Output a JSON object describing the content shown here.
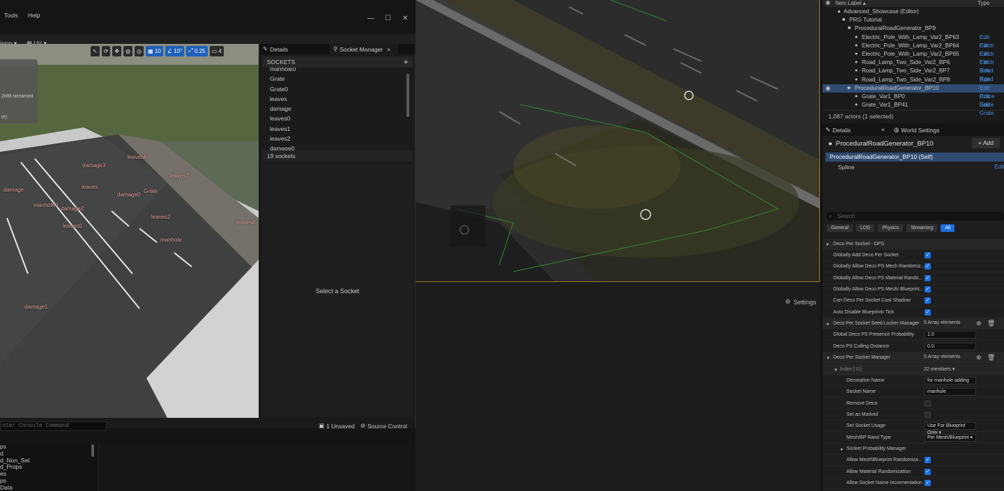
{
  "menubar": {
    "tools": "Tools",
    "help": "Help"
  },
  "window_controls": {
    "minimize": "—",
    "maximize": "☐",
    "close": "✕"
  },
  "toolbar": {
    "left_label": "ision",
    "uv_label": "UV"
  },
  "viewport_tools": {
    "grid": "10",
    "angle": "10°",
    "scale": "0.25",
    "camera": "4"
  },
  "stats_box": {
    "line1": "2MB streamed",
    "line2": "te)"
  },
  "viewport_tags": [
    "damage3",
    "leaves6",
    "leaves7",
    "leaves",
    "Grate",
    "damage",
    "damage0",
    "manhole0",
    "damage2",
    "leaves2",
    "leaves8",
    "leaves0",
    "manhole",
    "damage1"
  ],
  "panel_tabs": {
    "details": "Details",
    "socket_manager": "Socket Manager",
    "close": "×"
  },
  "sockets": {
    "header": "SOCKETS",
    "items": [
      "manhole0",
      "Grate",
      "Grate0",
      "leaves",
      "damage",
      "leaves0",
      "leaves1",
      "leaves2",
      "damage0"
    ],
    "count": "19 sockets",
    "empty_message": "Select a Socket"
  },
  "console": {
    "placeholder": "nter Console Command"
  },
  "status": {
    "unsaved": "1 Unsaved",
    "source_control": "Source Control"
  },
  "bottom_list": [
    "ps",
    "d",
    "d_Non_Set",
    "d_Props",
    "es",
    "ps",
    "Data"
  ],
  "settings": {
    "label": "Settings"
  },
  "outliner": {
    "col_label": "Item Label ▴",
    "col_type": "Type",
    "rows": [
      {
        "label": "Advanced_Showcase (Editor)",
        "edit": ""
      },
      {
        "label": "PRG Tutorial",
        "edit": ""
      },
      {
        "label": "ProceduralRoadGenerator_BP9",
        "edit": ""
      },
      {
        "label": "Electric_Pole_With_Lamp_Var2_BP63",
        "edit": "Edit Electr"
      },
      {
        "label": "Electric_Pole_With_Lamp_Var2_BP64",
        "edit": "Edit Electr"
      },
      {
        "label": "Electric_Pole_With_Lamp_Var2_BP65",
        "edit": "Edit Electr"
      },
      {
        "label": "Road_Lamp_Two_Side_Var2_BP6",
        "edit": "Edit Road"
      },
      {
        "label": "Road_Lamp_Two_Side_Var2_BP7",
        "edit": "Edit Road"
      },
      {
        "label": "Road_Lamp_Two_Side_Var2_BP8",
        "edit": "Edit Road"
      },
      {
        "label": "ProceduralRoadGenerator_BP10",
        "edit": "Edit Proce"
      },
      {
        "label": "Grate_Var1_BP0",
        "edit": "Edit Grate"
      },
      {
        "label": "Grate_Var1_BP41",
        "edit": "Edit Grate"
      }
    ],
    "footer": "1,087 actors (1 selected)"
  },
  "details": {
    "tab_details": "Details",
    "tab_world": "World Settings",
    "tab_close": "×",
    "actor_name": "ProceduralRoadGenerator_BP10",
    "add_button": "+ Add",
    "component_self": "ProceduralRoadGenerator_BP10 (Self)",
    "component_spline": "Spline",
    "component_spline_edit": "Edit",
    "search_placeholder": "Search",
    "filters": [
      "General",
      "LOD",
      "Physics",
      "Streaming",
      "All"
    ],
    "category": "Deco Per Socket - DPS",
    "properties": [
      {
        "label": "Globally Add Deco Per Socket",
        "type": "check",
        "value": "true"
      },
      {
        "label": "Globally Allow Deco PS Mesh Randomiz...",
        "type": "check",
        "value": "true"
      },
      {
        "label": "Globally Allow Deco PS Material Rando...",
        "type": "check",
        "value": "true"
      },
      {
        "label": "Globally Allow Deco PS Mesh/ Blueprint...",
        "type": "check",
        "value": "true"
      },
      {
        "label": "Can Deco Per Socket Cast Shadow",
        "type": "check",
        "value": "true"
      },
      {
        "label": "Auto Disable Blueprints Tick",
        "type": "check",
        "value": "true"
      },
      {
        "label": "Deco Per Socket Seed Locker Manager",
        "type": "array",
        "value": "5 Array elements"
      },
      {
        "label": "Global Deco PS Presence Probability",
        "type": "text",
        "value": "1.0"
      },
      {
        "label": "Deco PS Culling Distance",
        "type": "text",
        "value": "0.0"
      },
      {
        "label": "Deco Per Socket Manager",
        "type": "array",
        "value": "5 Array elements"
      },
      {
        "label": "Index [ 0 ]",
        "type": "members",
        "value": "22 members"
      },
      {
        "label": "Decoration Name",
        "type": "text",
        "value": "for manhole adding"
      },
      {
        "label": "Socket Name",
        "type": "text",
        "value": "manhole"
      },
      {
        "label": "Remove Deco",
        "type": "check",
        "value": "false"
      },
      {
        "label": "Set as Marked",
        "type": "check",
        "value": "false"
      },
      {
        "label": "Set Socket Usage",
        "type": "select",
        "value": "Use For Blueprint Only"
      },
      {
        "label": "Mesh/BP Rand Type",
        "type": "select",
        "value": "Per Mesh/Blueprint"
      },
      {
        "label": "Socket Probability Manager",
        "type": "none",
        "value": ""
      },
      {
        "label": "Allow Mesh\\Blueprint Randomiza...",
        "type": "check",
        "value": "true"
      },
      {
        "label": "Allow Material Randomization",
        "type": "check",
        "value": "true"
      },
      {
        "label": "Allow Socket Name Incrementation",
        "type": "check",
        "value": "true"
      }
    ]
  }
}
